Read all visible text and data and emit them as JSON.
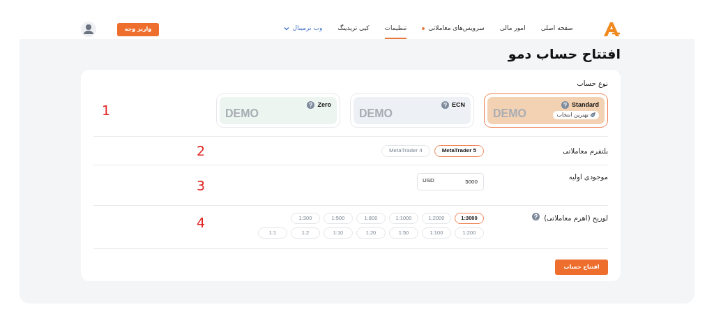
{
  "nav": {
    "items": [
      {
        "label": "صفحه اصلی",
        "selected": false,
        "dot": false,
        "dropdown": false
      },
      {
        "label": "امور مالی",
        "selected": false,
        "dot": false,
        "dropdown": false
      },
      {
        "label": "سرویس‌های معاملاتی",
        "selected": false,
        "dot": true,
        "dropdown": false
      },
      {
        "label": "تنظیمات",
        "selected": true,
        "dot": false,
        "dropdown": false
      },
      {
        "label": "کپی تریدینگ",
        "selected": false,
        "dot": false,
        "dropdown": false
      },
      {
        "label": "وب ترمینال",
        "selected": false,
        "dot": false,
        "dropdown": true
      }
    ],
    "deposit_button": "واریز وجه"
  },
  "page_title": "افتتاح حساب دمو",
  "account_type": {
    "label": "نوع حساب",
    "annotation": "1",
    "options": [
      {
        "name": "Standard",
        "badge": "بهترین انتخاب",
        "watermark": "DEMO",
        "selected": true,
        "color": "#f3d2b3"
      },
      {
        "name": "ECN",
        "watermark": "DEMO",
        "selected": false,
        "color": "#edf1f6"
      },
      {
        "name": "Zero",
        "watermark": "DEMO",
        "selected": false,
        "color": "#ecf5ef"
      }
    ]
  },
  "platform": {
    "label": "پلتفرم معاملاتی",
    "annotation": "2",
    "options": [
      {
        "label": "MetaTrader 5",
        "selected": true
      },
      {
        "label": "MetaTrader 4",
        "selected": false
      }
    ]
  },
  "balance": {
    "label": "موجودی اولیه",
    "annotation": "3",
    "value": "5000",
    "currency": "USD"
  },
  "leverage": {
    "label": "لوریج (اهرم معاملاتی)",
    "annotation": "4",
    "rows": [
      [
        {
          "label": "1:3000",
          "selected": true
        },
        {
          "label": "1:2000",
          "selected": false
        },
        {
          "label": "1:1000",
          "selected": false
        },
        {
          "label": "1:800",
          "selected": false
        },
        {
          "label": "1:500",
          "selected": false
        },
        {
          "label": "1:300",
          "selected": false
        }
      ],
      [
        {
          "label": "1:200",
          "selected": false
        },
        {
          "label": "1:100",
          "selected": false
        },
        {
          "label": "1:50",
          "selected": false
        },
        {
          "label": "1:20",
          "selected": false
        },
        {
          "label": "1:10",
          "selected": false
        },
        {
          "label": "1:2",
          "selected": false
        },
        {
          "label": "1:1",
          "selected": false
        }
      ]
    ]
  },
  "submit_button": "افتتاح حساب"
}
